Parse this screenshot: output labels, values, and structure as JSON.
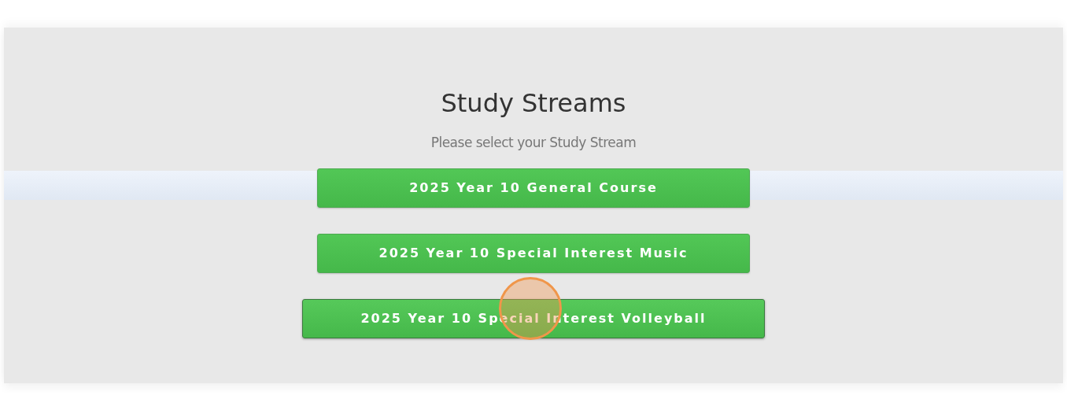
{
  "heading": "Study Streams",
  "instruction": "Please select your Study Stream",
  "streams": [
    {
      "label": "2025 Year 10 General Course",
      "selected": false
    },
    {
      "label": "2025 Year 10 Special Interest Music",
      "selected": false
    },
    {
      "label": "2025 Year 10 Special Interest Volleyball",
      "selected": true
    }
  ]
}
